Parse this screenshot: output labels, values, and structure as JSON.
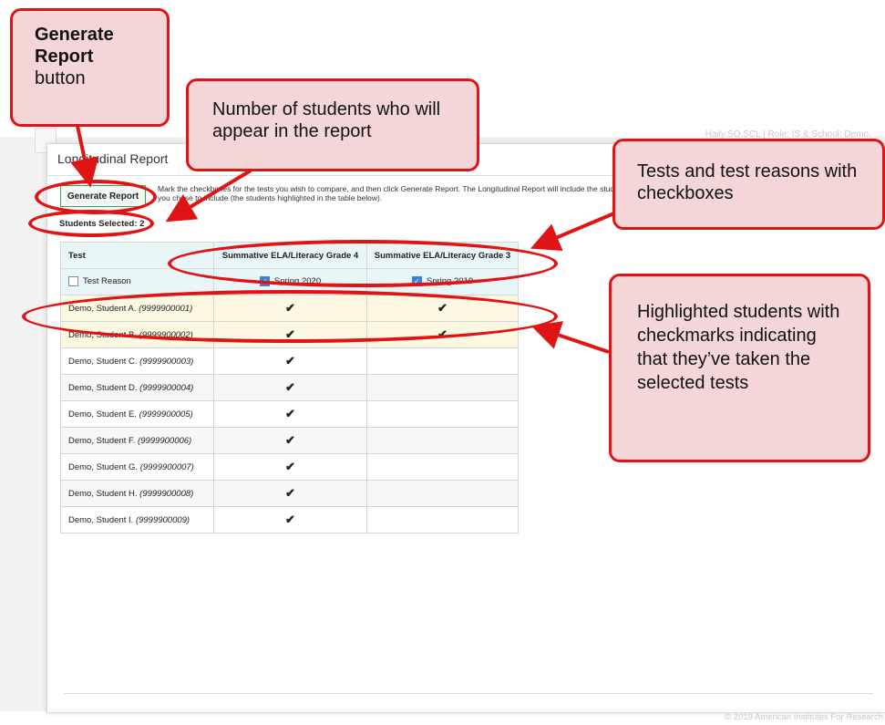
{
  "background": {
    "breadcrumb_text": "Haily.SO.SCL | Role: IS & School: Demo, ..."
  },
  "modal": {
    "title": "Longitudinal Report",
    "generate_button": "Generate Report",
    "instructions": "Mark the checkboxes for the tests you wish to compare, and then click Generate Report. The Longitudinal Report will include the students you chose to include (the students highlighted in the table below).",
    "students_selected": "Students Selected: 2"
  },
  "table": {
    "headers": [
      "Test",
      "Summative ELA/Literacy Grade 4",
      "Summative ELA/Literacy Grade 3"
    ],
    "reason_row": {
      "label": "Test Reason",
      "col2": "Spring 2020",
      "col3": "Spring 2019",
      "col2_checked": true,
      "col3_checked": true
    },
    "rows": [
      {
        "name": "Demo, Student A.",
        "id": "(9999900001)",
        "col2": "✔",
        "col3": "✔"
      },
      {
        "name": "Demo, Student B.",
        "id": "(9999900002)",
        "col2": "✔",
        "col3": "✔"
      },
      {
        "name": "Demo, Student C.",
        "id": "(9999900003)",
        "col2": "✔",
        "col3": ""
      },
      {
        "name": "Demo, Student D.",
        "id": "(9999900004)",
        "col2": "✔",
        "col3": ""
      },
      {
        "name": "Demo, Student E.",
        "id": "(9999900005)",
        "col2": "✔",
        "col3": ""
      },
      {
        "name": "Demo, Student F.",
        "id": "(9999900006)",
        "col2": "✔",
        "col3": ""
      },
      {
        "name": "Demo, Student G.",
        "id": "(9999900007)",
        "col2": "✔",
        "col3": ""
      },
      {
        "name": "Demo, Student H.",
        "id": "(9999900008)",
        "col2": "✔",
        "col3": ""
      },
      {
        "name": "Demo, Student I.",
        "id": "(9999900009)",
        "col2": "✔",
        "col3": ""
      }
    ]
  },
  "annotations": {
    "generate": {
      "bold": "Generate Report",
      "rest": "button"
    },
    "students_count": "Number of students who will appear in the report",
    "tests": "Tests and test reasons with checkboxes",
    "highlighted": "Highlighted students with checkmarks indicating that they’ve taken the selected tests"
  },
  "footer": "© 2019 American Institutes For Research",
  "colors": {
    "annotation_red": "#e01414",
    "annotation_fill": "#f4d6d8",
    "highlight_row": "#fdf8e2",
    "header_bg": "#e9f6f8",
    "button_border": "#4a9a5a"
  }
}
